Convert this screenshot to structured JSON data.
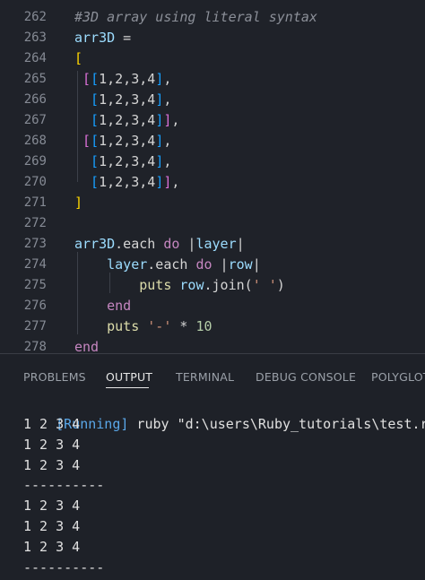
{
  "editor": {
    "lines": [
      {
        "num": "262",
        "tokens": [
          {
            "t": "#3D array using literal syntax",
            "c": "c-comment"
          }
        ]
      },
      {
        "num": "263",
        "tokens": [
          {
            "t": "arr3D",
            "c": "c-ident"
          },
          {
            "t": " =",
            "c": "c-plain"
          }
        ]
      },
      {
        "num": "264",
        "tokens": [
          {
            "t": "[",
            "c": "c-gold"
          }
        ]
      },
      {
        "num": "265",
        "tokens": [
          {
            "t": " [",
            "c": "c-violet"
          },
          {
            "t": "[",
            "c": "c-blue"
          },
          {
            "t": "1,2,3,4",
            "c": "c-plain"
          },
          {
            "t": "]",
            "c": "c-blue"
          },
          {
            "t": ",",
            "c": "c-plain"
          }
        ]
      },
      {
        "num": "266",
        "tokens": [
          {
            "t": "  [",
            "c": "c-blue"
          },
          {
            "t": "1,2,3,4",
            "c": "c-plain"
          },
          {
            "t": "]",
            "c": "c-blue"
          },
          {
            "t": ",",
            "c": "c-plain"
          }
        ]
      },
      {
        "num": "267",
        "tokens": [
          {
            "t": "  [",
            "c": "c-blue"
          },
          {
            "t": "1,2,3,4",
            "c": "c-plain"
          },
          {
            "t": "]",
            "c": "c-blue"
          },
          {
            "t": "]",
            "c": "c-violet"
          },
          {
            "t": ",",
            "c": "c-plain"
          }
        ]
      },
      {
        "num": "268",
        "tokens": [
          {
            "t": " [",
            "c": "c-violet"
          },
          {
            "t": "[",
            "c": "c-blue"
          },
          {
            "t": "1,2,3,4",
            "c": "c-plain"
          },
          {
            "t": "]",
            "c": "c-blue"
          },
          {
            "t": ",",
            "c": "c-plain"
          }
        ]
      },
      {
        "num": "269",
        "tokens": [
          {
            "t": "  [",
            "c": "c-blue"
          },
          {
            "t": "1,2,3,4",
            "c": "c-plain"
          },
          {
            "t": "]",
            "c": "c-blue"
          },
          {
            "t": ",",
            "c": "c-plain"
          }
        ]
      },
      {
        "num": "270",
        "tokens": [
          {
            "t": "  [",
            "c": "c-blue"
          },
          {
            "t": "1,2,3,4",
            "c": "c-plain"
          },
          {
            "t": "]",
            "c": "c-blue"
          },
          {
            "t": "]",
            "c": "c-violet"
          },
          {
            "t": ",",
            "c": "c-plain"
          }
        ]
      },
      {
        "num": "271",
        "tokens": [
          {
            "t": "]",
            "c": "c-gold"
          }
        ]
      },
      {
        "num": "272",
        "tokens": []
      },
      {
        "num": "273",
        "tokens": [
          {
            "t": "arr3D",
            "c": "c-ident"
          },
          {
            "t": ".each ",
            "c": "c-plain"
          },
          {
            "t": "do",
            "c": "c-kw"
          },
          {
            "t": " |",
            "c": "c-plain"
          },
          {
            "t": "layer",
            "c": "c-ident"
          },
          {
            "t": "|",
            "c": "c-plain"
          }
        ]
      },
      {
        "num": "274",
        "tokens": [
          {
            "t": "    layer",
            "c": "c-ident"
          },
          {
            "t": ".each ",
            "c": "c-plain"
          },
          {
            "t": "do",
            "c": "c-kw"
          },
          {
            "t": " |",
            "c": "c-plain"
          },
          {
            "t": "row",
            "c": "c-ident"
          },
          {
            "t": "|",
            "c": "c-plain"
          }
        ]
      },
      {
        "num": "275",
        "tokens": [
          {
            "t": "        puts ",
            "c": "c-fn"
          },
          {
            "t": "row",
            "c": "c-ident"
          },
          {
            "t": ".join(",
            "c": "c-plain"
          },
          {
            "t": "' '",
            "c": "c-str"
          },
          {
            "t": ")",
            "c": "c-plain"
          }
        ]
      },
      {
        "num": "276",
        "tokens": [
          {
            "t": "    end",
            "c": "c-kw"
          }
        ]
      },
      {
        "num": "277",
        "tokens": [
          {
            "t": "    puts ",
            "c": "c-fn"
          },
          {
            "t": "'-'",
            "c": "c-str"
          },
          {
            "t": " * ",
            "c": "c-plain"
          },
          {
            "t": "10",
            "c": "c-num"
          }
        ]
      },
      {
        "num": "278",
        "tokens": [
          {
            "t": "end",
            "c": "c-kw"
          }
        ]
      }
    ]
  },
  "panel": {
    "tabs": [
      {
        "label": "PROBLEMS",
        "active": false
      },
      {
        "label": "OUTPUT",
        "active": true
      },
      {
        "label": "TERMINAL",
        "active": false
      },
      {
        "label": "DEBUG CONSOLE",
        "active": false
      },
      {
        "label": "POLYGLOT",
        "active": false
      }
    ],
    "output": {
      "running_tag": "[Running]",
      "command": " ruby \"d:\\users\\Ruby_tutorials\\test.rb\"",
      "lines": [
        "1 2 3 4",
        "1 2 3 4",
        "1 2 3 4",
        "----------",
        "1 2 3 4",
        "1 2 3 4",
        "1 2 3 4",
        "----------"
      ]
    }
  }
}
